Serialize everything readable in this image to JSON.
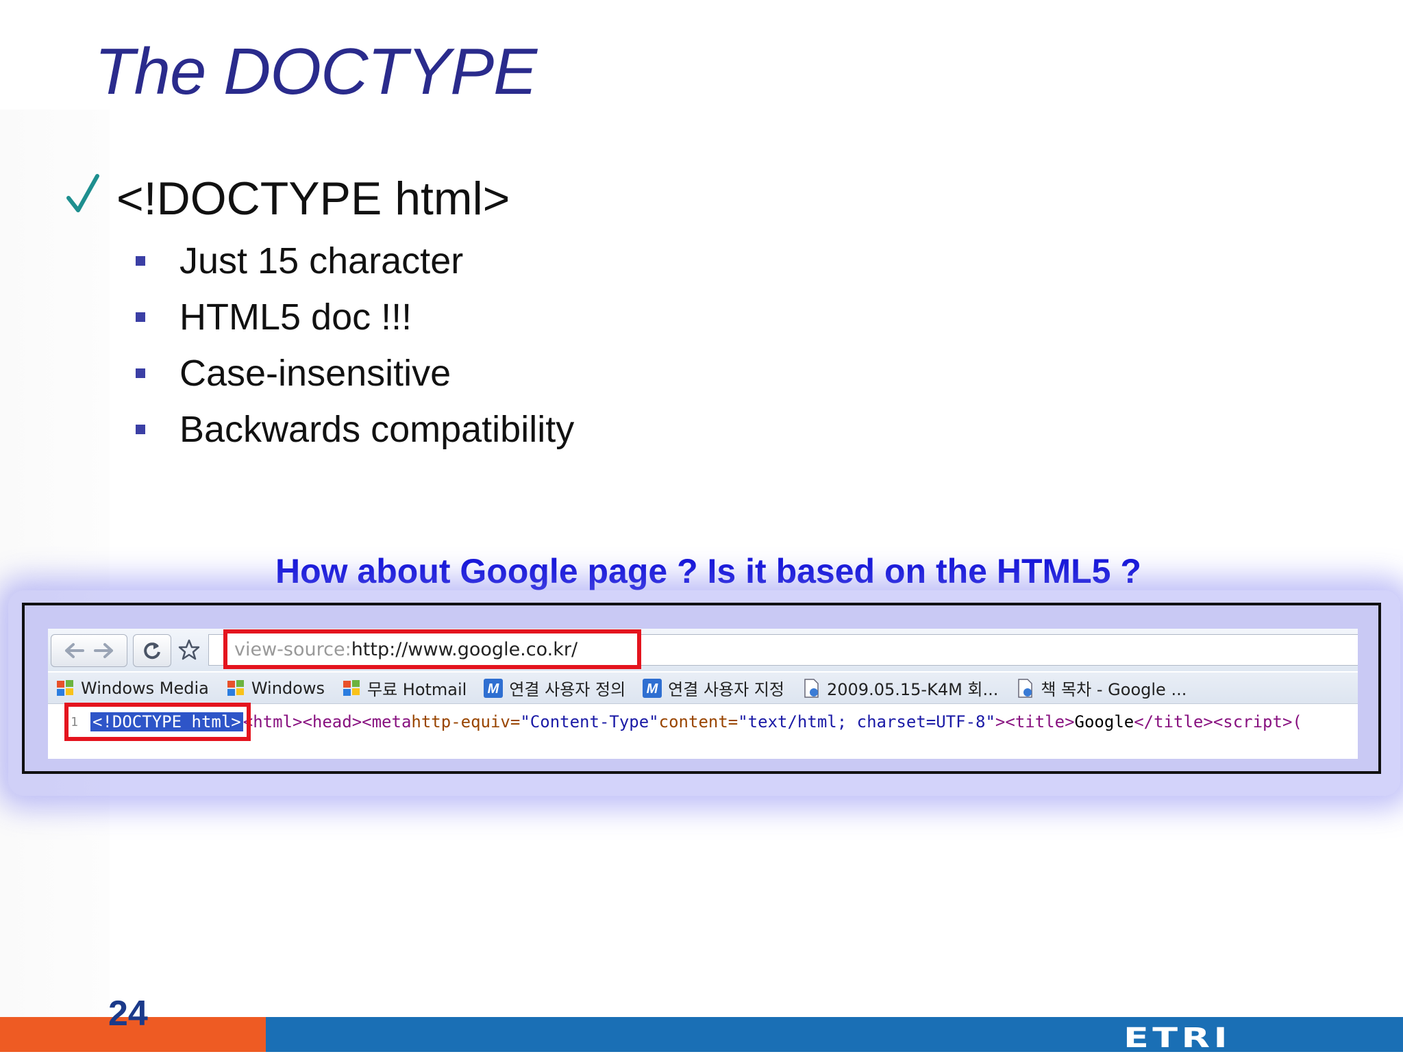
{
  "slide": {
    "title": "The DOCTYPE",
    "main_bullet": "<!DOCTYPE html>",
    "sub_bullets": [
      "Just 15 character",
      "HTML5 doc !!!",
      "Case-insensitive",
      "Backwards compatibility"
    ],
    "question": "How about Google page ? Is it based on the HTML5 ?",
    "page_number": "24",
    "logo_text": "ETRI"
  },
  "browser": {
    "url": "view-source:http://www.google.co.kr/",
    "url_prefix": "view-source:",
    "url_main": "http://www.google.co.kr/",
    "bookmarks": [
      {
        "label": "Windows Media",
        "icon": "windows-icon"
      },
      {
        "label": "Windows",
        "icon": "windows-icon"
      },
      {
        "label": "무료 Hotmail",
        "icon": "windows-icon"
      },
      {
        "label": "연결 사용자 정의",
        "icon": "m-icon"
      },
      {
        "label": "연결 사용자 지정",
        "icon": "m-icon"
      },
      {
        "label": "2009.05.15-K4M 회...",
        "icon": "page-icon"
      },
      {
        "label": "책 목차 - Google ...",
        "icon": "page-icon"
      }
    ],
    "source": {
      "line_number": "1",
      "doctype": "<!DOCTYPE html>",
      "open_tags": "<html><head><meta ",
      "attr1": "http-equiv=",
      "val1": "\"Content-Type\" ",
      "attr2": "content=",
      "val2": "\"text/html; charset=UTF-8\"",
      "close_meta": "><title>",
      "title_text": "Google",
      "rest": "</title><script>("
    }
  },
  "colors": {
    "title": "#2a2b8c",
    "question": "#1414d8",
    "highlight_box": "#e4141e",
    "footer_orange": "#ee5b23",
    "footer_blue": "#1a6fb5"
  }
}
